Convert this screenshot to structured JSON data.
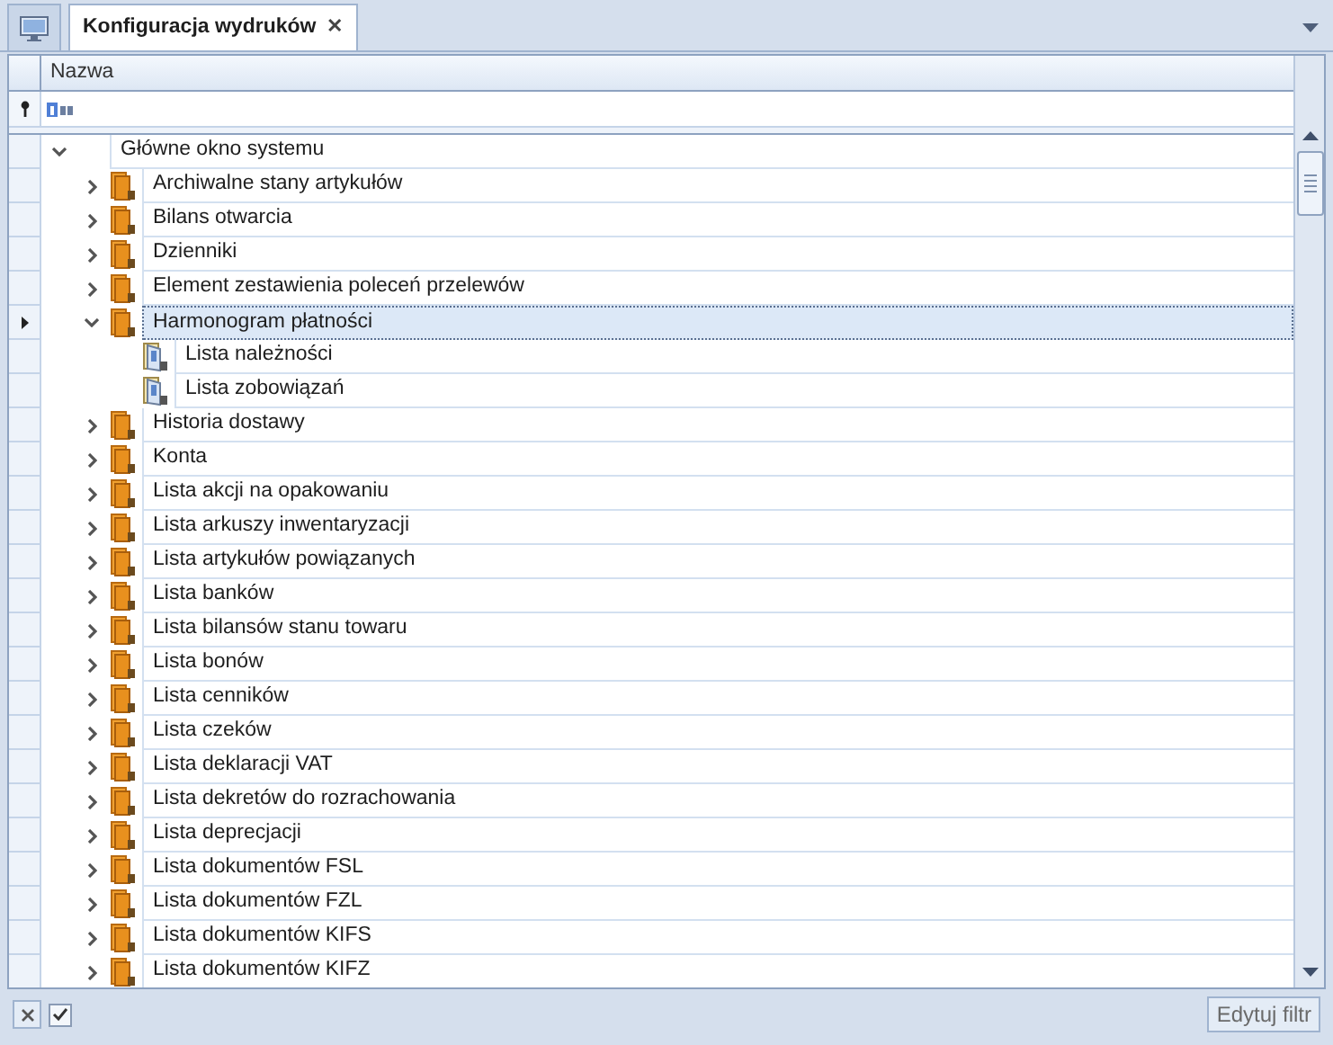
{
  "tabs": [
    {
      "kind": "icon",
      "selected": false
    },
    {
      "kind": "text",
      "label": "Konfiguracja wydruków",
      "close": "✕",
      "selected": true
    }
  ],
  "grid": {
    "columns": [
      {
        "label": "Nazwa"
      }
    ],
    "tree": [
      {
        "label": "Główne okno systemu",
        "expanded": true,
        "selected": false,
        "children": [
          {
            "label": "Archiwalne stany artykułów",
            "kind": "folder",
            "expanded": false,
            "selected": false
          },
          {
            "label": "Bilans otwarcia",
            "kind": "folder",
            "expanded": false,
            "selected": false
          },
          {
            "label": "Dzienniki",
            "kind": "folder",
            "expanded": false,
            "selected": false
          },
          {
            "label": "Element zestawienia poleceń przelewów",
            "kind": "folder",
            "expanded": false,
            "selected": false
          },
          {
            "label": "Harmonogram płatności",
            "kind": "folder",
            "expanded": true,
            "selected": true,
            "children": [
              {
                "label": "Lista należności",
                "kind": "report",
                "selected": false
              },
              {
                "label": "Lista zobowiązań",
                "kind": "report",
                "selected": false
              }
            ]
          },
          {
            "label": "Historia dostawy",
            "kind": "folder",
            "expanded": false,
            "selected": false
          },
          {
            "label": "Konta",
            "kind": "folder",
            "expanded": false,
            "selected": false
          },
          {
            "label": "Lista akcji na opakowaniu",
            "kind": "folder",
            "expanded": false,
            "selected": false
          },
          {
            "label": "Lista arkuszy inwentaryzacji",
            "kind": "folder",
            "expanded": false,
            "selected": false
          },
          {
            "label": "Lista artykułów powiązanych",
            "kind": "folder",
            "expanded": false,
            "selected": false
          },
          {
            "label": "Lista banków",
            "kind": "folder",
            "expanded": false,
            "selected": false
          },
          {
            "label": "Lista bilansów stanu towaru",
            "kind": "folder",
            "expanded": false,
            "selected": false
          },
          {
            "label": "Lista bonów",
            "kind": "folder",
            "expanded": false,
            "selected": false
          },
          {
            "label": "Lista cenników",
            "kind": "folder",
            "expanded": false,
            "selected": false
          },
          {
            "label": "Lista czeków",
            "kind": "folder",
            "expanded": false,
            "selected": false
          },
          {
            "label": "Lista deklaracji VAT",
            "kind": "folder",
            "expanded": false,
            "selected": false
          },
          {
            "label": "Lista dekretów do rozrachowania",
            "kind": "folder",
            "expanded": false,
            "selected": false
          },
          {
            "label": "Lista deprecjacji",
            "kind": "folder",
            "expanded": false,
            "selected": false
          },
          {
            "label": "Lista dokumentów FSL",
            "kind": "folder",
            "expanded": false,
            "selected": false
          },
          {
            "label": "Lista dokumentów FZL",
            "kind": "folder",
            "expanded": false,
            "selected": false
          },
          {
            "label": "Lista dokumentów KIFS",
            "kind": "folder",
            "expanded": false,
            "selected": false
          },
          {
            "label": "Lista dokumentów KIFZ",
            "kind": "folder",
            "expanded": false,
            "selected": false
          }
        ]
      }
    ]
  },
  "footer": {
    "filter_checked": true,
    "button": "Edytuj filtr"
  }
}
